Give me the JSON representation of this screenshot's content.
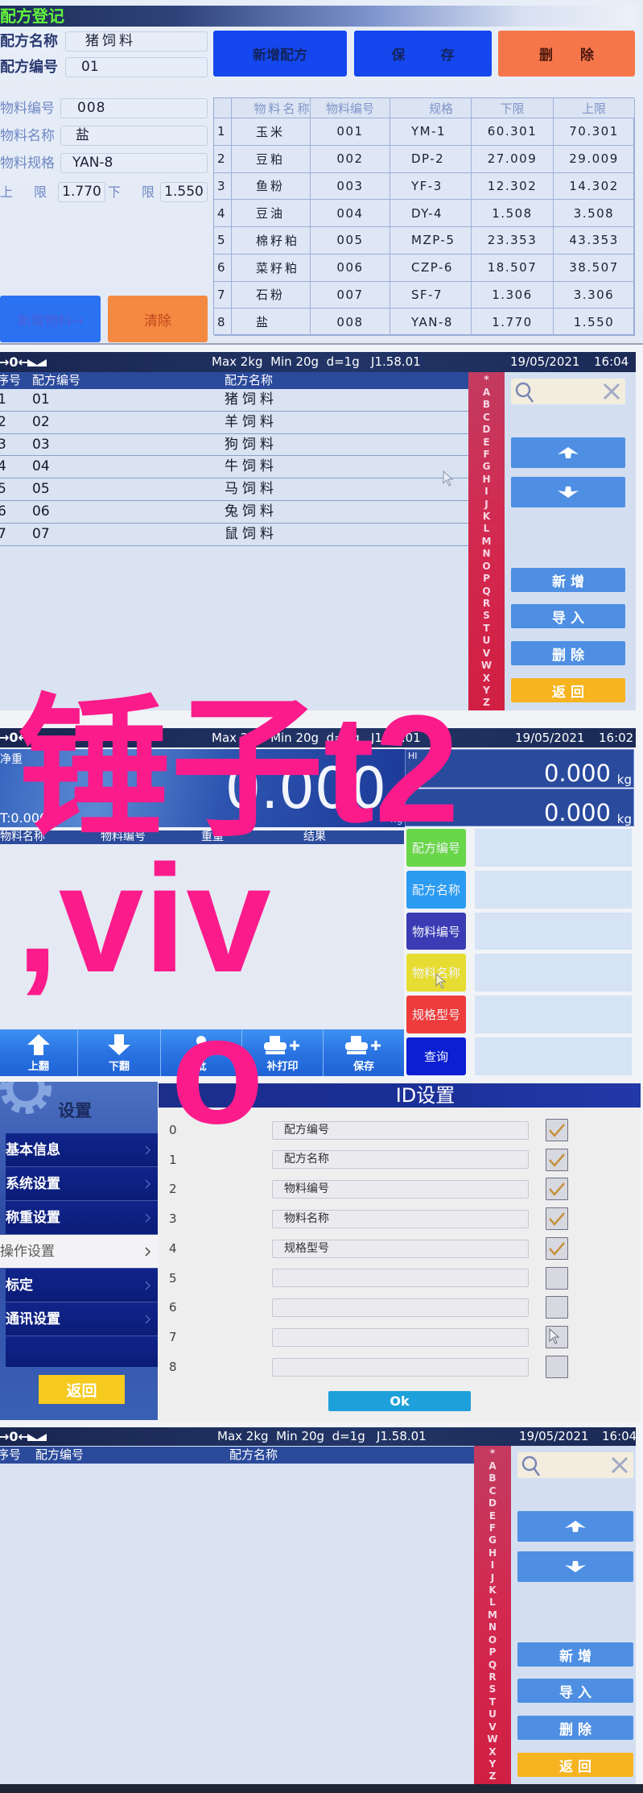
{
  "recipe_register": {
    "title": "配方登记",
    "recipe_name": {
      "label": "配方名称",
      "value": "猪饲料"
    },
    "recipe_code": {
      "label": "配方编号",
      "value": "01"
    },
    "material_code": {
      "label": "物料编号",
      "value": "008"
    },
    "material_name": {
      "label": "物料名称",
      "value": "盐"
    },
    "material_spec": {
      "label": "物料规格",
      "value": "YAN-8"
    },
    "upper_limit": {
      "label": "上限",
      "value": "1.770"
    },
    "lower_limit": {
      "label": "下限",
      "value": "1.550"
    },
    "buttons": {
      "new_recipe": "新增配方",
      "save": "保存",
      "delete": "删除",
      "add_material": "新增物料→",
      "clear": "清除"
    },
    "colors": {
      "title_text": "#62f43a",
      "primary_button": "#1447ee",
      "delete_button": "#f4764a",
      "add_material_button": "#2a72f2",
      "clear_button": "#f48a42"
    },
    "table": {
      "headers": [
        "",
        "物料名称",
        "物料编号",
        "规格",
        "下限",
        "上限"
      ],
      "rows": [
        [
          "1",
          "玉米",
          "001",
          "YM-1",
          "60.301",
          "70.301"
        ],
        [
          "2",
          "豆粕",
          "002",
          "DP-2",
          "27.009",
          "29.009"
        ],
        [
          "3",
          "鱼粉",
          "003",
          "YF-3",
          "12.302",
          "14.302"
        ],
        [
          "4",
          "豆油",
          "004",
          "DY-4",
          "1.508",
          "3.508"
        ],
        [
          "5",
          "棉籽粕",
          "005",
          "MZP-5",
          "23.353",
          "43.353"
        ],
        [
          "6",
          "菜籽粕",
          "006",
          "CZP-6",
          "18.507",
          "38.507"
        ],
        [
          "7",
          "石粉",
          "007",
          "SF-7",
          "1.306",
          "3.306"
        ],
        [
          "8",
          "盐",
          "008",
          "YAN-8",
          "1.770",
          "1.550"
        ]
      ]
    }
  },
  "status_bar": {
    "zero_indicator": "→0←",
    "spec": "Max 2kg  Min 20g  d=1g   J1.58.01"
  },
  "alphabet": [
    "*",
    "A",
    "B",
    "C",
    "D",
    "E",
    "F",
    "G",
    "H",
    "I",
    "J",
    "K",
    "L",
    "M",
    "N",
    "O",
    "P",
    "Q",
    "R",
    "S",
    "T",
    "U",
    "V",
    "W",
    "X",
    "Y",
    "Z"
  ],
  "recipe_list": {
    "date": "19/05/2021",
    "time": "16:04",
    "headers": {
      "index": "序号",
      "code": "配方编号",
      "name": "配方名称"
    },
    "rows": [
      {
        "index": "1",
        "code": "01",
        "name": "猪饲料"
      },
      {
        "index": "2",
        "code": "02",
        "name": "羊饲料"
      },
      {
        "index": "3",
        "code": "03",
        "name": "狗饲料"
      },
      {
        "index": "4",
        "code": "04",
        "name": "牛饲料"
      },
      {
        "index": "5",
        "code": "05",
        "name": "马饲料"
      },
      {
        "index": "6",
        "code": "06",
        "name": "兔饲料"
      },
      {
        "index": "7",
        "code": "07",
        "name": "鼠饲料"
      }
    ],
    "search_value": "",
    "buttons": {
      "new": "新增",
      "import": "导入",
      "delete": "删除",
      "back": "返回"
    },
    "colors": {
      "action_button": "#4e8fe3",
      "back_button": "#f6b421"
    }
  },
  "weighing": {
    "date": "19/05/2021",
    "time": "16:02",
    "net_label": "净重",
    "net_weight": "0.000",
    "unit": "kg",
    "tare": "T:0.000",
    "hi_label": "HI",
    "hi_value": "0.000",
    "lo_value": "0.000",
    "headers": {
      "material_name": "物料名称",
      "material_code": "物料编号",
      "weight": "重量",
      "result": "结果"
    },
    "query_buttons": [
      {
        "label": "配方编号",
        "color": "#6ad64a"
      },
      {
        "label": "配方名称",
        "color": "#2b9cf2"
      },
      {
        "label": "物料编号",
        "color": "#3b3cb4"
      },
      {
        "label": "物料名称",
        "color": "#e6dc32"
      },
      {
        "label": "规格型号",
        "color": "#ee3b3b"
      },
      {
        "label": "查询",
        "color": "#0c1fd2"
      }
    ],
    "query_values": [
      "",
      "",
      "",
      "",
      "",
      ""
    ],
    "toolbar": [
      {
        "label": "上翻",
        "icon": "page-up-icon"
      },
      {
        "label": "下翻",
        "icon": "page-down-icon"
      },
      {
        "label": "批",
        "icon": "batch-icon"
      },
      {
        "label": "补打印",
        "icon": "printer-plus-icon"
      },
      {
        "label": "保存",
        "icon": "printer-plus-icon"
      }
    ]
  },
  "settings": {
    "title": "设置",
    "menu": [
      {
        "label": "基本信息",
        "selected": false
      },
      {
        "label": "系统设置",
        "selected": false
      },
      {
        "label": "称重设置",
        "selected": false
      },
      {
        "label": "操作设置",
        "selected": true
      },
      {
        "label": "标定",
        "selected": false
      },
      {
        "label": "通讯设置",
        "selected": false
      }
    ],
    "back": "返回",
    "colors": {
      "back_button": "#f6ca1e",
      "ok_button": "#1ea1da",
      "check_mark": "#c4913c"
    },
    "dialog": {
      "title": "ID设置",
      "rows": [
        {
          "index": "0",
          "value": "配方编号",
          "checked": true
        },
        {
          "index": "1",
          "value": "配方名称",
          "checked": true
        },
        {
          "index": "2",
          "value": "物料编号",
          "checked": true
        },
        {
          "index": "3",
          "value": "物料名称",
          "checked": true
        },
        {
          "index": "4",
          "value": "规格型号",
          "checked": true
        },
        {
          "index": "5",
          "value": "",
          "checked": false
        },
        {
          "index": "6",
          "value": "",
          "checked": false
        },
        {
          "index": "7",
          "value": "",
          "checked": false
        },
        {
          "index": "8",
          "value": "",
          "checked": false
        }
      ],
      "ok": "Ok"
    }
  },
  "recipe_list_empty": {
    "date": "19/05/2021",
    "time": "16:04",
    "headers": {
      "index": "序号",
      "code": "配方编号",
      "name": "配方名称"
    },
    "rows": [],
    "search_value": "",
    "buttons": {
      "new": "新增",
      "import": "导入",
      "delete": "删除",
      "back": "返回"
    }
  },
  "watermark": {
    "lines": [
      "锤子t2",
      ",viv",
      "o"
    ],
    "color": "#fb1b8b"
  }
}
